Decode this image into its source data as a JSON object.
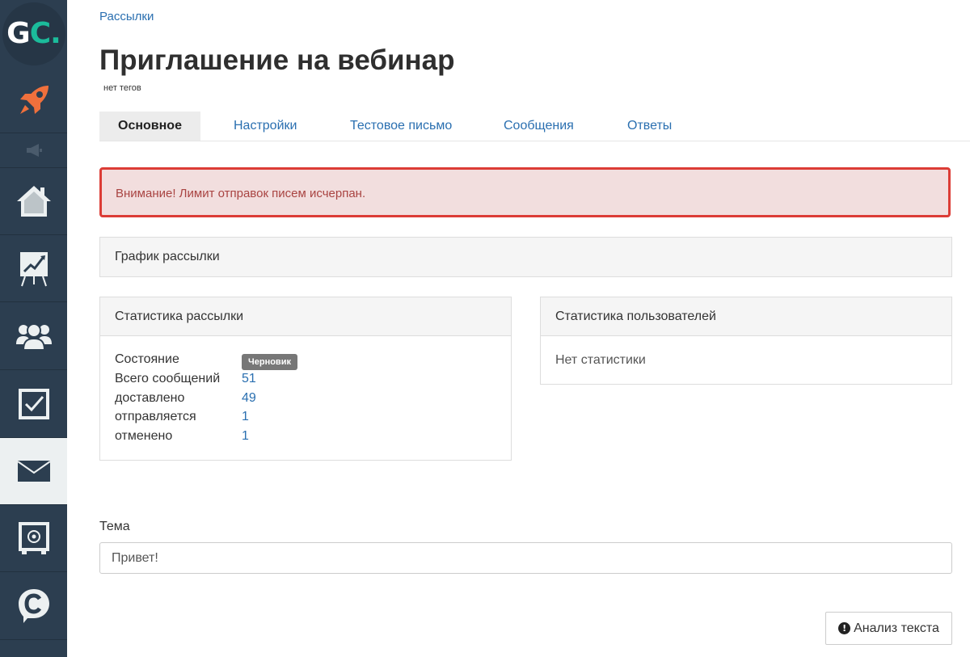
{
  "sidebar": {
    "logo": {
      "letter_g": "G",
      "letter_c": "C",
      "dot": ".",
      "accent_color": "#1bbc9b"
    },
    "items": [
      {
        "icon": "rocket-icon",
        "color": "#f0703c"
      },
      {
        "icon": "megaphone-icon"
      },
      {
        "icon": "home-icon"
      },
      {
        "icon": "chart-board-icon"
      },
      {
        "icon": "users-icon"
      },
      {
        "icon": "checkbox-icon"
      },
      {
        "icon": "envelope-icon",
        "active": true
      },
      {
        "icon": "safe-icon"
      },
      {
        "icon": "chat-c-icon"
      }
    ]
  },
  "breadcrumb": "Рассылки",
  "title": "Приглашение на вебинар",
  "tags": "нет тегов",
  "tabs": [
    {
      "label": "Основное",
      "active": true
    },
    {
      "label": "Настройки"
    },
    {
      "label": "Тестовое письмо"
    },
    {
      "label": "Сообщения"
    },
    {
      "label": "Ответы"
    }
  ],
  "alert": {
    "text": "Внимание! Лимит отправок писем исчерпан.",
    "border_color": "#dc3c36",
    "bg_color": "#f2dede"
  },
  "schedule_panel": {
    "title": "График рассылки"
  },
  "mailing_stats": {
    "title": "Статистика рассылки",
    "rows": [
      {
        "label": "Состояние",
        "badge": "Черновик"
      },
      {
        "label": "Всего сообщений",
        "value": "51"
      },
      {
        "label": "доставлено",
        "value": "49"
      },
      {
        "label": "отправляется",
        "value": "1"
      },
      {
        "label": "отменено",
        "value": "1"
      }
    ]
  },
  "user_stats": {
    "title": "Статистика пользователей",
    "empty": "Нет статистики"
  },
  "topic": {
    "label": "Тема",
    "value": "Привет!"
  },
  "analyze_button": {
    "label": "Анализ текста",
    "icon": "exclamation-circle-icon"
  }
}
